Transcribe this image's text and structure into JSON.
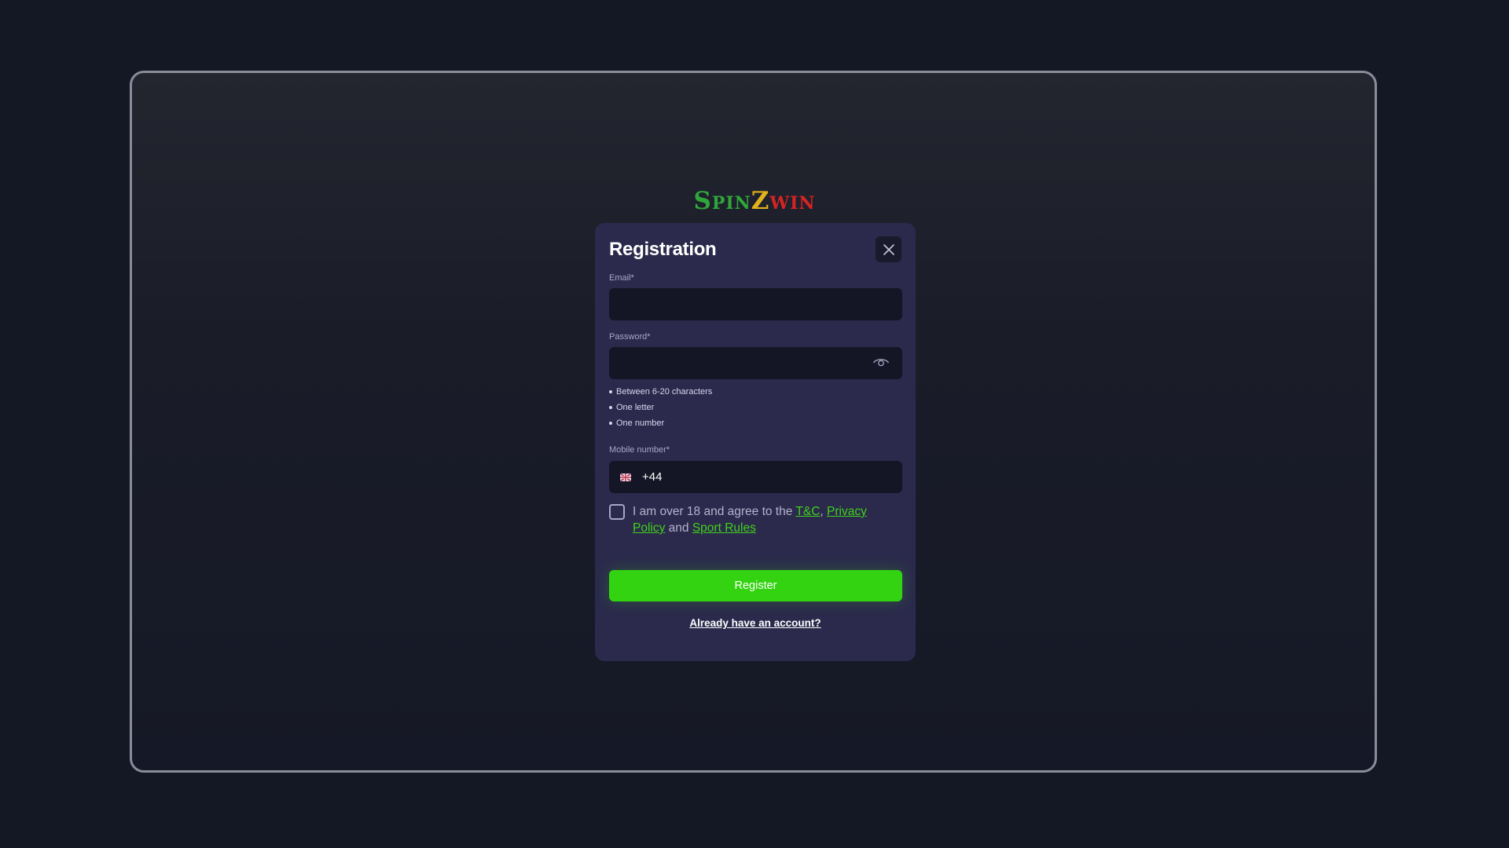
{
  "logo": {
    "part1_first": "S",
    "part1_rest": "PIN",
    "part2": "Z",
    "part3": "WIN"
  },
  "modal": {
    "title": "Registration",
    "email": {
      "label": "Email*",
      "value": "",
      "placeholder": ""
    },
    "password": {
      "label": "Password*",
      "value": "",
      "placeholder": "",
      "rules": [
        "Between 6-20 characters",
        "One letter",
        "One number"
      ]
    },
    "mobile": {
      "label": "Mobile number*",
      "country_code": "+44"
    },
    "agreement": {
      "text_before": "I am over 18 and agree to the ",
      "tc_link": "T&C",
      "comma": ", ",
      "privacy_link": "Privacy Policy",
      "and_text": " and ",
      "sport_rules_link": "Sport Rules"
    },
    "register_label": "Register",
    "login_link": "Already have an account?"
  },
  "colors": {
    "accent": "#33d311",
    "link": "#40d11a",
    "modal_bg": "#2b2a4c",
    "input_bg": "#151625"
  }
}
